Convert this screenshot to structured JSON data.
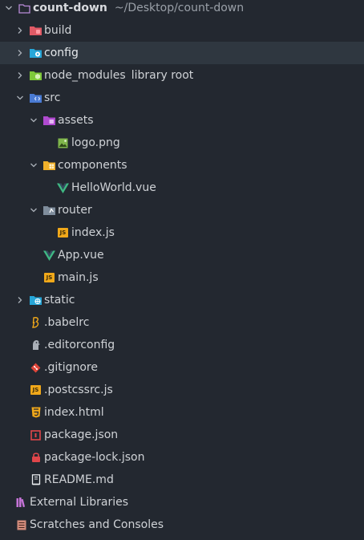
{
  "project": {
    "name": "count-down",
    "path": "~/Desktop/count-down"
  },
  "items": [
    {
      "label": "build",
      "extra": "",
      "icon": "folder-icon",
      "color": "#e05a66"
    },
    {
      "label": "config",
      "extra": "",
      "icon": "config-folder-icon",
      "color": "#26a6d8"
    },
    {
      "label": "node_modules",
      "extra": "library root",
      "icon": "node-folder-icon",
      "color": "#7ec83a"
    },
    {
      "label": "src",
      "extra": "",
      "icon": "src-folder-icon",
      "color": "#4a7bd4"
    },
    {
      "label": "assets",
      "extra": "",
      "icon": "assets-folder-icon",
      "color": "#b04ad0"
    },
    {
      "label": "logo.png",
      "extra": "",
      "icon": "image-icon",
      "color": "#7fb64b"
    },
    {
      "label": "components",
      "extra": "",
      "icon": "components-folder-icon",
      "color": "#f0b02a"
    },
    {
      "label": "HelloWorld.vue",
      "extra": "",
      "icon": "vue-icon",
      "color": "#3fb883"
    },
    {
      "label": "router",
      "extra": "",
      "icon": "router-folder-icon",
      "color": "#7f8d9c"
    },
    {
      "label": "index.js",
      "extra": "",
      "icon": "js-icon",
      "color": "#f0a81a",
      "badge": "JS"
    },
    {
      "label": "App.vue",
      "extra": "",
      "icon": "vue-icon",
      "color": "#3fb883"
    },
    {
      "label": "main.js",
      "extra": "",
      "icon": "js-icon",
      "color": "#f0a81a",
      "badge": "JS"
    },
    {
      "label": "static",
      "extra": "",
      "icon": "static-folder-icon",
      "color": "#26a6d8"
    },
    {
      "label": ".babelrc",
      "extra": "",
      "icon": "babel-icon",
      "color": "#f0a81a"
    },
    {
      "label": ".editorconfig",
      "extra": "",
      "icon": "editorconfig-icon",
      "color": "#aab0b8"
    },
    {
      "label": ".gitignore",
      "extra": "",
      "icon": "git-icon",
      "color": "#e0463a"
    },
    {
      "label": ".postcssrc.js",
      "extra": "",
      "icon": "js-icon",
      "color": "#f0a81a",
      "badge": "JS"
    },
    {
      "label": "index.html",
      "extra": "",
      "icon": "html-icon",
      "color": "#f0a81a"
    },
    {
      "label": "package.json",
      "extra": "",
      "icon": "npm-icon",
      "color": "#e0464a"
    },
    {
      "label": "package-lock.json",
      "extra": "",
      "icon": "lock-icon",
      "color": "#e0464a"
    },
    {
      "label": "README.md",
      "extra": "",
      "icon": "readme-icon",
      "color": "#e8ecef"
    }
  ],
  "footer": {
    "external_libraries": "External Libraries",
    "scratches": "Scratches and Consoles"
  },
  "colors": {
    "background": "#232830",
    "selected_row": "#2f3740",
    "text": "#cfd2d6",
    "muted_text": "#9aa0a8"
  }
}
